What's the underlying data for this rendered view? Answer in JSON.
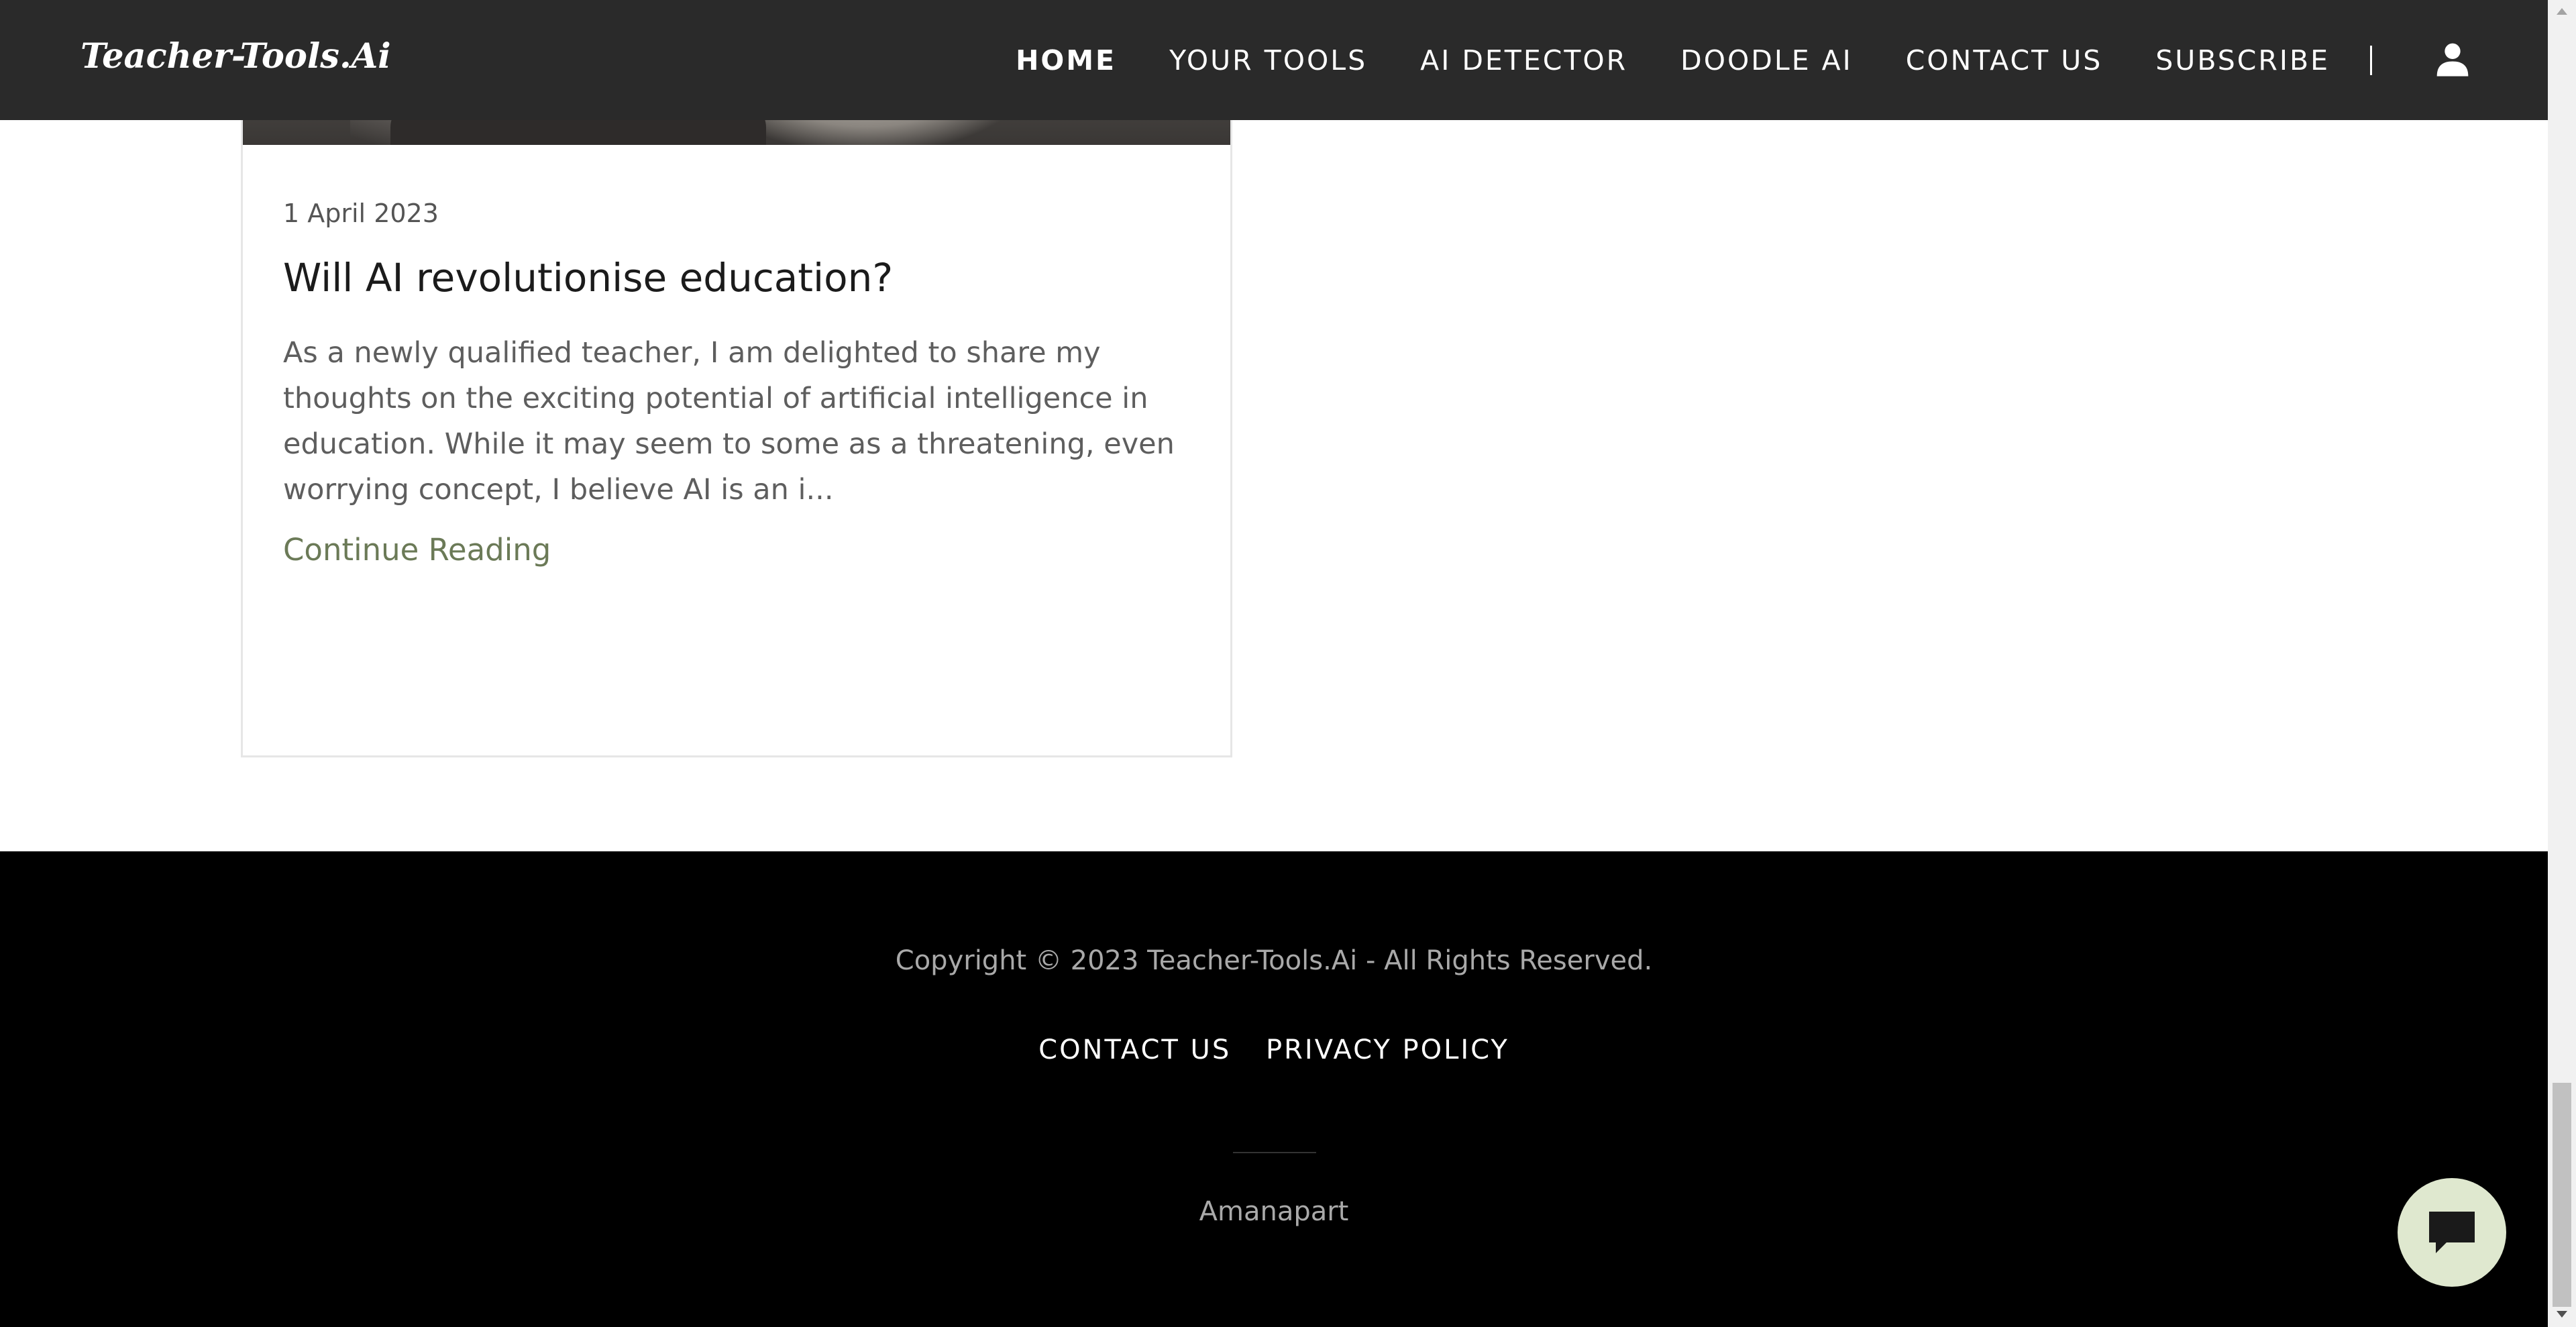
{
  "header": {
    "brand": "Teacher-Tools.Ai",
    "nav": [
      {
        "label": "HOME",
        "active": true
      },
      {
        "label": "YOUR TOOLS",
        "active": false
      },
      {
        "label": "AI DETECTOR",
        "active": false
      },
      {
        "label": "DOODLE AI",
        "active": false
      },
      {
        "label": "CONTACT US",
        "active": false
      },
      {
        "label": "SUBSCRIBE",
        "active": false
      }
    ],
    "user_icon": "user-icon"
  },
  "article": {
    "date": "1 April 2023",
    "title": "Will AI revolutionise education?",
    "excerpt": "As a newly qualified teacher, I am delighted to share my thoughts on the exciting potential of artificial intelligence in education. While it may seem to some as a threatening, even worrying concept, I believe AI is an i...",
    "link_label": "Continue Reading"
  },
  "footer": {
    "copyright": "Copyright © 2023 Teacher-Tools.Ai - All Rights Reserved.",
    "links": [
      "CONTACT US",
      "PRIVACY POLICY"
    ],
    "credit": "Amanapart"
  },
  "chat": {
    "icon": "chat-icon"
  },
  "colors": {
    "header_bg": "#2a2a2a",
    "footer_bg": "#000000",
    "link_accent": "#6b7a57",
    "chat_bg": "#dfe8cf"
  }
}
